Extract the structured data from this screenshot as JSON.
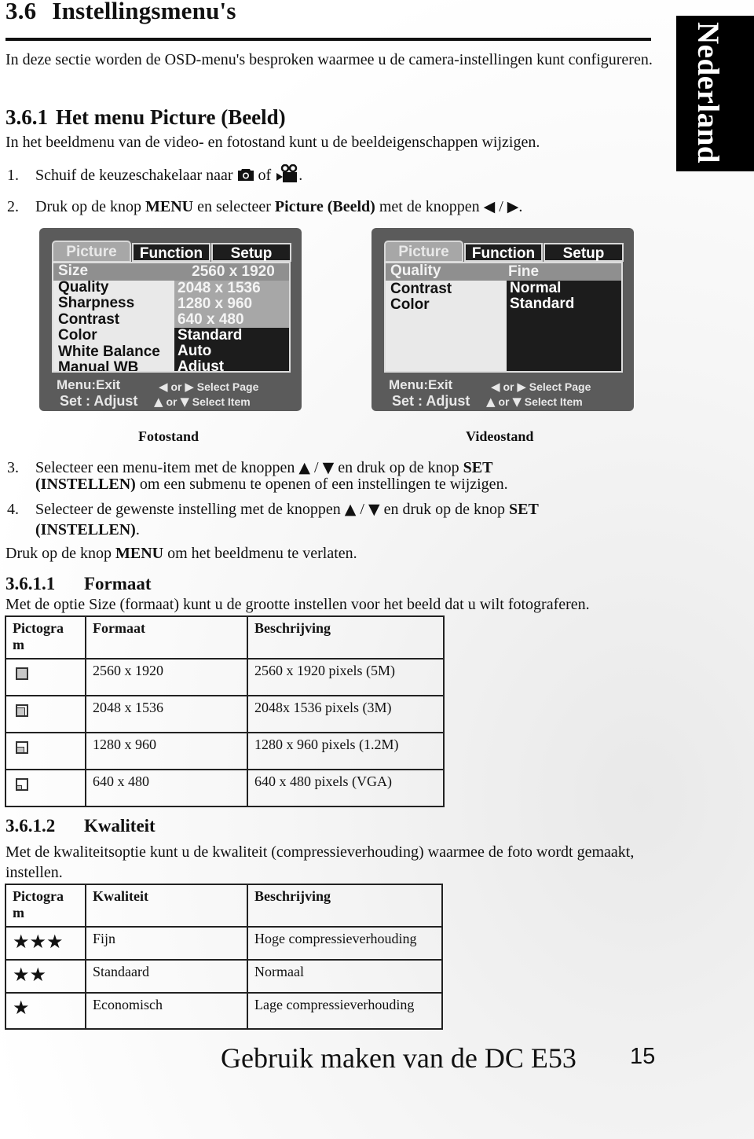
{
  "section": {
    "number": "3.6",
    "title": "Instellingsmenu's",
    "intro": "In deze sectie worden de OSD-menu's besproken waarmee u de camera-instellingen kunt configureren."
  },
  "language_tab": "Nederland",
  "subsection": {
    "number": "3.6.1",
    "title": "Het menu Picture (Beeld)",
    "intro": "In het beeldmenu van de video- en fotostand kunt u de beeldeigenschappen wijzigen."
  },
  "steps": {
    "s1": {
      "n": "1.",
      "pre": "Schuif de keuzeschakelaar naar ",
      "icon1": "camera-icon",
      "mid": " of ",
      "icon2": "video-camera-icon",
      "post": "."
    },
    "s2": {
      "n": "2.",
      "pre": "Druk op de knop ",
      "b1": "MENU",
      "mid": " en selecteer ",
      "b2": "Picture (Beeld)",
      "post": " met de knoppen ",
      "left": "◀",
      "sep": " / ",
      "right": "▶",
      "end": "."
    },
    "s3": {
      "n": "3.",
      "pre": "Selecteer een menu-item met de knoppen ",
      "up": "▲",
      "sep": " / ",
      "down": "▼",
      "mid": " en druk op de knop ",
      "b1": "SET",
      "b2": "(INSTELLEN)",
      "post": " om een submenu te openen of een instellingen te wijzigen."
    },
    "s4": {
      "n": "4.",
      "pre": "Selecteer de gewenste instelling met de knoppen ",
      "up": "▲",
      "sep": " / ",
      "down": "▼",
      "mid": " en druk op de knop ",
      "b1": "SET",
      "b2": "(INSTELLEN)",
      "post": "."
    },
    "exit": {
      "pre": "Druk op de knop ",
      "b1": "MENU",
      "post": " om het beeldmenu te verlaten."
    }
  },
  "osd_photo": {
    "caption": "Fotostand",
    "tabs": [
      "Picture",
      "Function",
      "Setup"
    ],
    "items": [
      "Size",
      "Quality",
      "Sharpness",
      "Contrast",
      "Color",
      "White Balance",
      "Manual WB"
    ],
    "selected_value": "2560 x 1920",
    "size_options": [
      "2048 x 1536",
      "1280 x 960",
      "640 x 480"
    ],
    "values": [
      "Standard",
      "Auto",
      "Adjust"
    ],
    "footer": {
      "menu": "Menu:Exit",
      "set": "Set : Adjust",
      "page_hint": "or",
      "page_text": "Select Page",
      "item_hint": "or",
      "item_text": "Select Item"
    }
  },
  "osd_video": {
    "caption": "Videostand",
    "tabs": [
      "Picture",
      "Function",
      "Setup"
    ],
    "items": [
      "Quality",
      "Contrast",
      "Color"
    ],
    "selected_value": "Fine",
    "values": [
      "Normal",
      "Standard"
    ],
    "footer": {
      "menu": "Menu:Exit",
      "set": "Set : Adjust",
      "page_hint": "or",
      "page_text": "Select Page",
      "item_hint": "or",
      "item_text": "Select Item"
    }
  },
  "formaat": {
    "number": "3.6.1.1",
    "title": "Formaat",
    "intro": "Met de optie Size (formaat) kunt u de grootte instellen voor het beeld dat u wilt fotograferen.",
    "headers": [
      "Pictogra m",
      "Formaat",
      "Beschrijving"
    ],
    "rows": [
      {
        "icon": "size-5m-icon",
        "format": "2560 x 1920",
        "desc": "2560 x 1920 pixels (5M)"
      },
      {
        "icon": "size-3m-icon",
        "format": "2048 x 1536",
        "desc": "2048x 1536 pixels (3M)"
      },
      {
        "icon": "size-1-2m-icon",
        "format": "1280 x 960",
        "desc": "1280 x 960 pixels (1.2M)"
      },
      {
        "icon": "size-vga-icon",
        "format": "640 x 480",
        "desc": "640 x 480 pixels (VGA)"
      }
    ]
  },
  "kwaliteit": {
    "number": "3.6.1.2",
    "title": "Kwaliteit",
    "intro": "Met de kwaliteitsoptie kunt u de kwaliteit (compressieverhouding) waarmee de foto wordt gemaakt, instellen.",
    "headers": [
      "Pictogra m",
      "Kwaliteit",
      "Beschrijving"
    ],
    "rows": [
      {
        "stars": "★★★",
        "rating": 3,
        "quality": "Fijn",
        "desc": "Hoge compressieverhouding"
      },
      {
        "stars": "★★",
        "rating": 2,
        "quality": "Standaard",
        "desc": "Normaal"
      },
      {
        "stars": "★",
        "rating": 1,
        "quality": "Economisch",
        "desc": "Lage compressieverhouding"
      }
    ]
  },
  "footer": {
    "title": "Gebruik maken van de DC E53",
    "page": "15"
  }
}
